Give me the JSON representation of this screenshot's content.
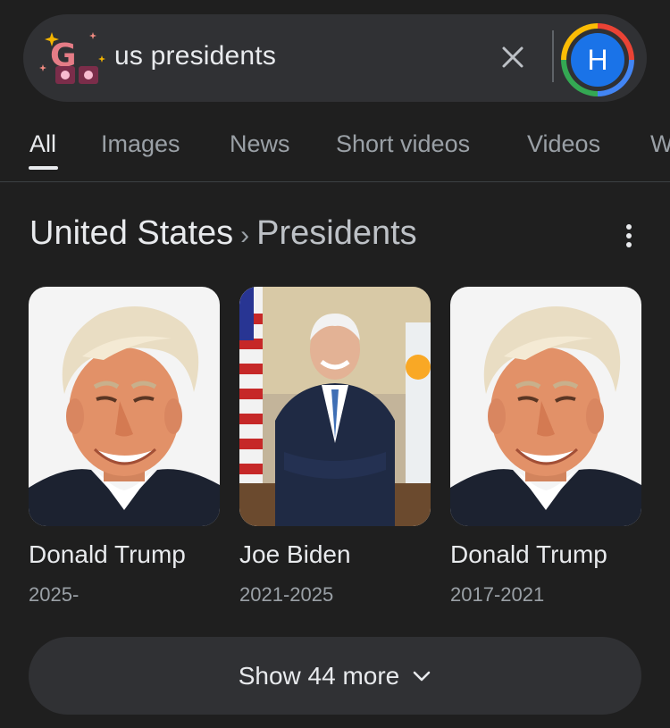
{
  "search": {
    "query": "us presidents",
    "avatar_letter": "H"
  },
  "tabs": [
    {
      "label": "All",
      "active": true
    },
    {
      "label": "Images"
    },
    {
      "label": "News"
    },
    {
      "label": "Short videos"
    },
    {
      "label": "Videos"
    },
    {
      "label": "W"
    }
  ],
  "breadcrumb": {
    "parent": "United States",
    "separator": "›",
    "current": "Presidents"
  },
  "presidents": [
    {
      "name": "Donald Trump",
      "years": "2025-"
    },
    {
      "name": "Joe Biden",
      "years": "2021-2025"
    },
    {
      "name": "Donald Trump",
      "years": "2017-2021"
    }
  ],
  "show_more": {
    "label": "Show 44 more",
    "icon": "chevron-down-icon"
  },
  "colors": {
    "background": "#1f1f1f",
    "surface": "#303134",
    "avatar": "#1a73e8",
    "text_primary": "#e8eaed",
    "text_secondary": "#9aa0a6"
  }
}
